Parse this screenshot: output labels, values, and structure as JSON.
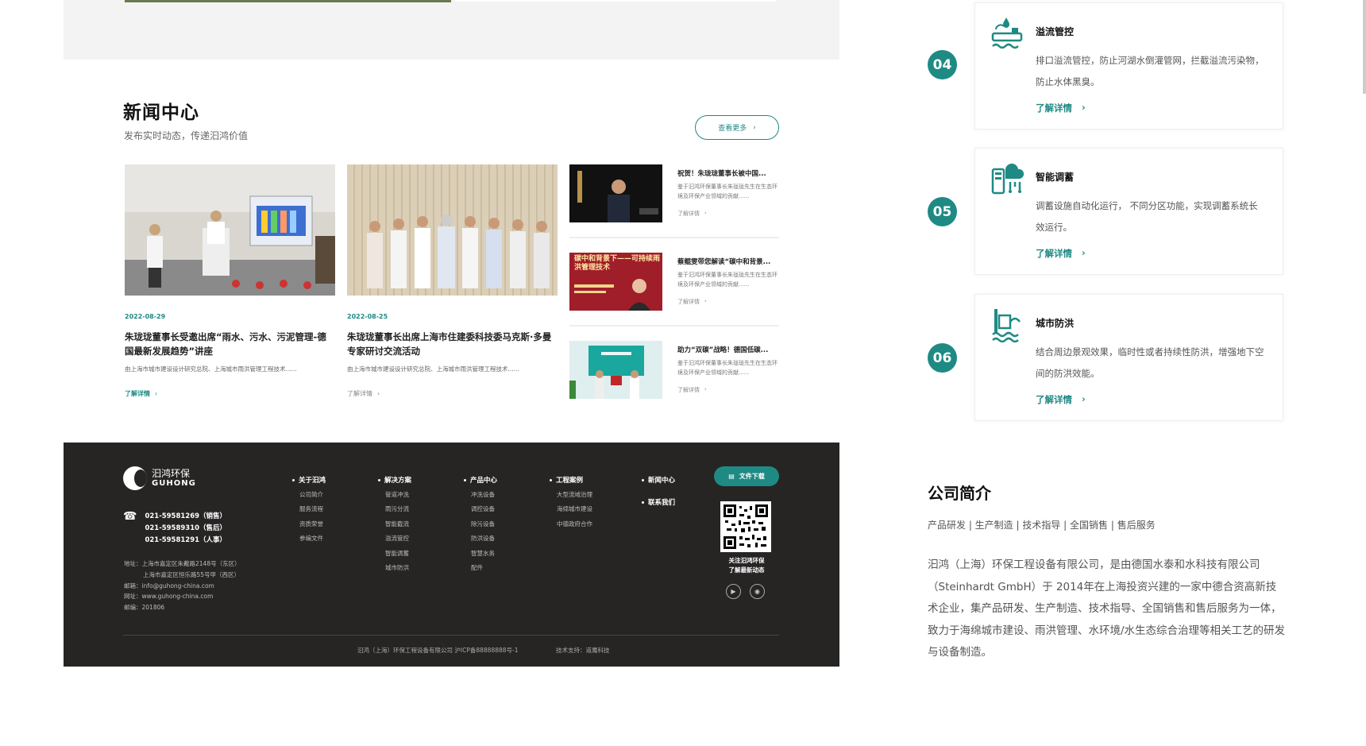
{
  "news": {
    "title": "新闻中心",
    "subtitle": "发布实时动态，传递汩鸿价值",
    "view_more": "查看更多",
    "read_more": "了解详情",
    "featured": [
      {
        "date": "2022-08-29",
        "title": "朱珑珑董事长受邀出席“雨水、污水、污泥管理-德国最新发展趋势”讲座",
        "desc": "由上海市城市建设设计研究总院、上海城市雨洪管理工程技术......"
      },
      {
        "date": "2022-08-25",
        "title": "朱珑珑董事长出席上海市住建委科技委马克斯·多曼专家研讨交流活动",
        "desc": "由上海市城市建设设计研究总院、上海城市雨洪管理工程技术......"
      }
    ],
    "list": [
      {
        "title": "祝贺！朱珑珑董事长被中国...",
        "desc": "鉴于汩鸿环保董事长朱珑珑先生在生态环境及环保产业领域的贡献......"
      },
      {
        "title": "蔡鲲雯带您解读“碳中和背景...",
        "desc": "鉴于汩鸿环保董事长朱珑珑先生在生态环境及环保产业领域的贡献......",
        "thumb_text": "碳中和背景下——可持续雨洪管理技术"
      },
      {
        "title": "助力“双碳”战略！德国低碳...",
        "desc": "鉴于汩鸿环保董事长朱珑珑先生在生态环境及环保产业领域的贡献......"
      }
    ]
  },
  "footer": {
    "logo_cn": "汩鸿环保",
    "logo_en": "GUHONG",
    "phones": [
      "021-59581269（销售）",
      "021-59589310（售后）",
      "021-59581291（人事）"
    ],
    "address": [
      "地址：上海市嘉定区朱戴路2148号（东区）",
      "上海市嘉定区恒乐路55号甲（西区）",
      "邮箱：info@guhong-china.com",
      "网址：www.guhong-china.com",
      "邮编：201806"
    ],
    "columns": [
      {
        "heading": "关于汩鸿",
        "items": [
          "公司简介",
          "服务流程",
          "资质荣誉",
          "参编文件"
        ]
      },
      {
        "heading": "解决方案",
        "items": [
          "管道冲洗",
          "雨污分流",
          "智能截流",
          "溢流管控",
          "智能调蓄",
          "城市防洪"
        ]
      },
      {
        "heading": "产品中心",
        "items": [
          "冲洗设备",
          "调控设备",
          "除污设备",
          "防洪设备",
          "智慧水务",
          "配件"
        ]
      },
      {
        "heading": "工程案例",
        "items": [
          "大型流域治理",
          "海绵城市建设",
          "中德政府合作"
        ]
      },
      {
        "heading": "新闻中心",
        "items": []
      },
      {
        "heading": "联系我们",
        "items": []
      }
    ],
    "download": "文件下载",
    "qr_caption": [
      "关注汩鸿环保",
      "了解最新动态"
    ],
    "copyright": "汩鸿（上海）环保工程设备有限公司 沪ICP备88888888号-1",
    "tech": "技术支持：道鹰科技"
  },
  "features": [
    {
      "num": "04",
      "title": "溢流管控",
      "desc": "排口溢流管控，防止河湖水倒灌管网，拦截溢流污染物，防止水体黑臭。",
      "icon": "overflow-icon"
    },
    {
      "num": "05",
      "title": "智能调蓄",
      "desc": "调蓄设施自动化运行， 不同分区功能，实现调蓄系统长效运行。",
      "icon": "smart-storage-icon"
    },
    {
      "num": "06",
      "title": "城市防洪",
      "desc": "结合周边景观效果，临时性或者持续性防洪，增强地下空间的防洪效能。",
      "icon": "flood-control-icon"
    }
  ],
  "feature_more": "了解详情",
  "intro": {
    "title": "公司简介",
    "tags": "产品研发 | 生产制造 | 技术指导 | 全国销售 | 售后服务",
    "body": "汩鸿（上海）环保工程设备有限公司，是由德国水泰和水科技有限公司（Steinhardt GmbH）于 2014年在上海投资兴建的一家中德合资高新技术企业，集产品研发、生产制造、技术指导、全国销售和售后服务为一体，致力于海绵城市建设、雨洪管理、水环境/水生态综合治理等相关工艺的研发与设备制造。"
  },
  "colors": {
    "accent": "#1f8a84",
    "footer_bg": "#272424"
  }
}
